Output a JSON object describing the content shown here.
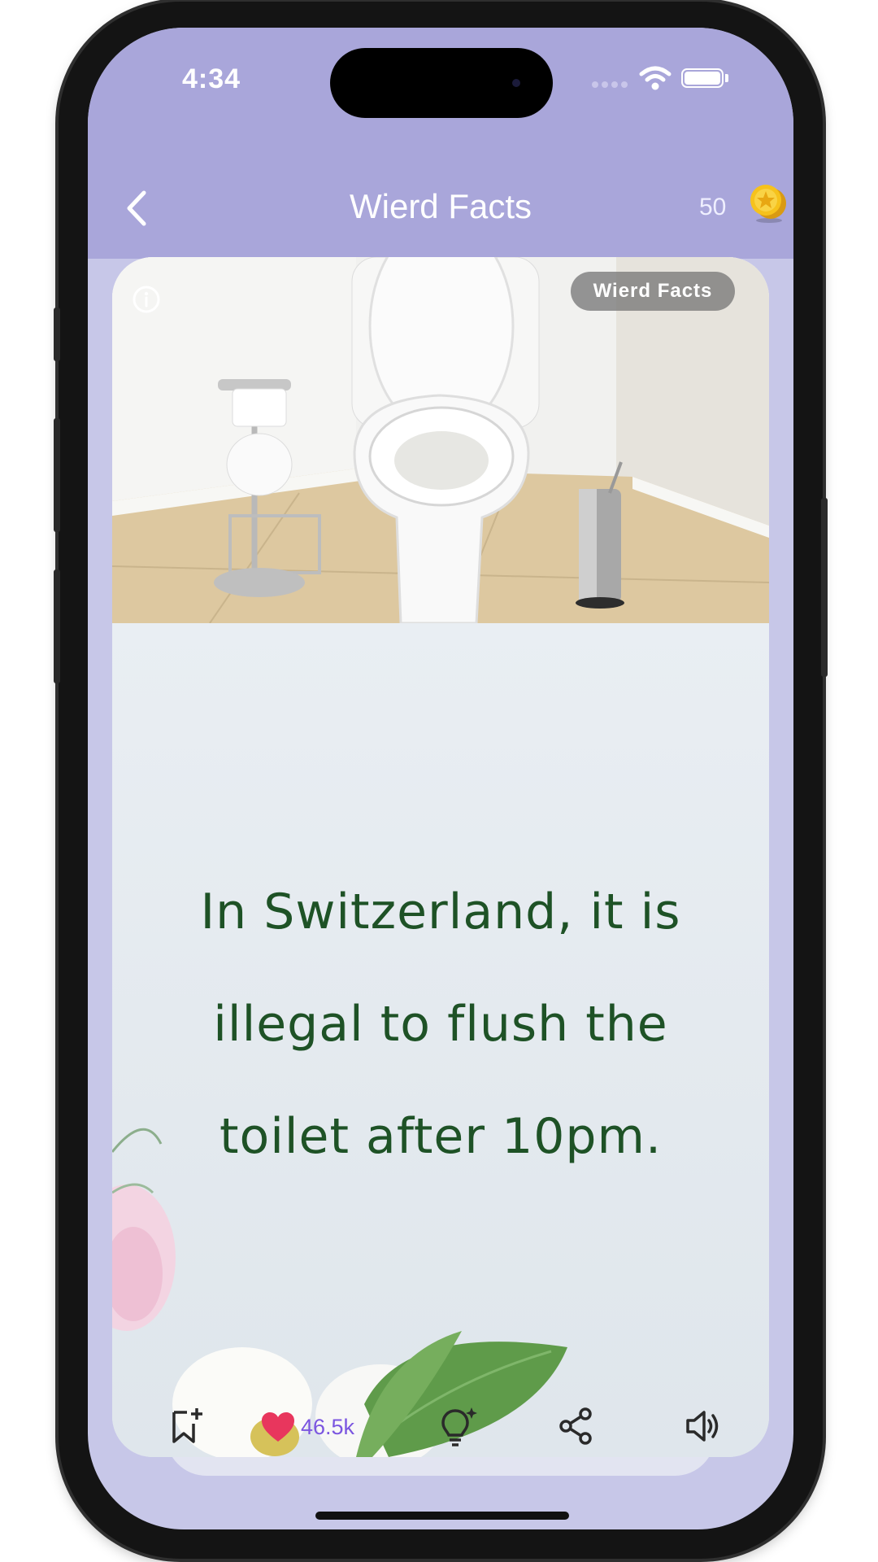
{
  "status_bar": {
    "time": "4:34"
  },
  "header": {
    "title": "Wierd Facts",
    "coins": "50",
    "back_icon": "chevron-left-icon",
    "coin_icon": "gold-coin-icon"
  },
  "card": {
    "category": "Wierd Facts",
    "photo_icon": "toilet-photo",
    "fact_lines": [
      "In Switzerland, it is",
      "illegal to flush the",
      "toilet after 10pm."
    ],
    "text_color": "#1e5226"
  },
  "actions": {
    "likes": "46.5k",
    "icons": [
      "bookmark-add-icon",
      "heart-icon",
      "lightbulb-icon",
      "share-icon",
      "speaker-icon"
    ]
  },
  "colors": {
    "header": "#a9a6da",
    "background": "#c7c7e8",
    "like": "#e8365d",
    "like_count": "#7b56e0"
  }
}
